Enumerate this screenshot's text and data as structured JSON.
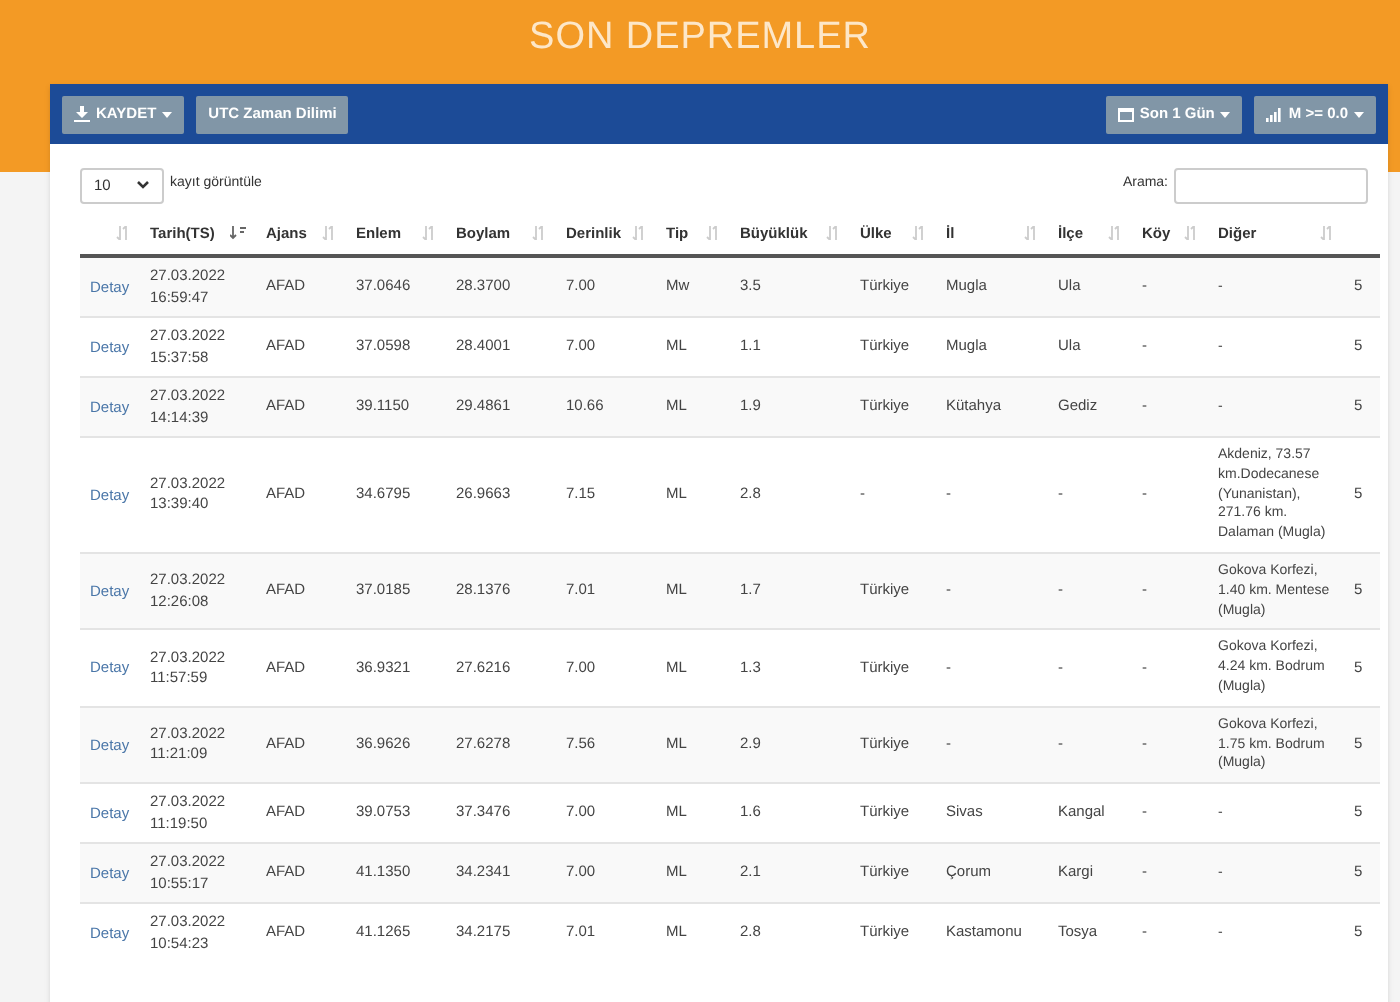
{
  "header": {
    "title": "SON DEPREMLER"
  },
  "toolbar": {
    "left_buttons": [
      {
        "label": "KAYDET",
        "dropdown": true
      },
      {
        "label": "UTC Zaman Dilimi",
        "dropdown": false
      }
    ],
    "right_buttons": [
      {
        "label": "Son 1 Gün",
        "dropdown": true
      },
      {
        "label": "M >= 0.0",
        "dropdown": true
      }
    ]
  },
  "length_select": {
    "value": "10",
    "label": "kayıt görüntüle"
  },
  "search": {
    "label": "Arama:"
  },
  "table": {
    "columns": [
      {
        "sorted": false
      },
      {
        "label": "Tarih(TS)",
        "sorted": true
      },
      {
        "label": "Ajans",
        "sorted": false
      },
      {
        "label": "Enlem",
        "sorted": false
      },
      {
        "label": "Boylam",
        "sorted": false
      },
      {
        "label": "Derinlik",
        "sorted": false
      },
      {
        "label": "Tip",
        "sorted": false
      },
      {
        "label": "Büyüklük",
        "sorted": false
      },
      {
        "label": "Ülke",
        "sorted": false
      },
      {
        "label": "İl",
        "sorted": false
      },
      {
        "label": "İlçe",
        "sorted": false
      },
      {
        "label": "Köy",
        "sorted": false
      },
      {
        "label": "Diğer",
        "sorted": false
      }
    ],
    "rows": [
      {
        "link": "Detay",
        "date": "27.03.2022",
        "time": "16:59:47",
        "agency": "AFAD",
        "lat": "37.0646",
        "lon": "28.3700",
        "depth": "7.00",
        "type": "Mw",
        "mag": "3.5",
        "country": "Türkiye",
        "province": "Mugla",
        "district": "Ula",
        "village": "-",
        "other": "-",
        "column_14": "5"
      },
      {
        "link": "Detay",
        "date": "27.03.2022",
        "time": "15:37:58",
        "agency": "AFAD",
        "lat": "37.0598",
        "lon": "28.4001",
        "depth": "7.00",
        "type": "ML",
        "mag": "1.1",
        "country": "Türkiye",
        "province": "Mugla",
        "district": "Ula",
        "village": "-",
        "other": "-",
        "column_14": "5"
      },
      {
        "link": "Detay",
        "date": "27.03.2022",
        "time": "14:14:39",
        "agency": "AFAD",
        "lat": "39.1150",
        "lon": "29.4861",
        "depth": "10.66",
        "type": "ML",
        "mag": "1.9",
        "country": "Türkiye",
        "province": "Kütahya",
        "district": "Gediz",
        "village": "-",
        "other": "-",
        "column_14": "5"
      },
      {
        "link": "Detay",
        "date": "27.03.2022",
        "time": "13:39:40",
        "agency": "AFAD",
        "lat": "34.6795",
        "lon": "26.9663",
        "depth": "7.15",
        "type": "ML",
        "mag": "2.8",
        "country": "-",
        "province": "-",
        "district": "-",
        "village": "-",
        "other": "Akdeniz, 73.57 km.Dodecanese (Yunanistan), 271.76 km. Dalaman (Mugla)",
        "column_14": "5"
      },
      {
        "link": "Detay",
        "date": "27.03.2022",
        "time": "12:26:08",
        "agency": "AFAD",
        "lat": "37.0185",
        "lon": "28.1376",
        "depth": "7.01",
        "type": "ML",
        "mag": "1.7",
        "country": "Türkiye",
        "province": "-",
        "district": "-",
        "village": "-",
        "other": "Gokova Korfezi, 1.40 km. Mentese (Mugla)",
        "column_14": "5"
      },
      {
        "link": "Detay",
        "date": "27.03.2022",
        "time": "11:57:59",
        "agency": "AFAD",
        "lat": "36.9321",
        "lon": "27.6216",
        "depth": "7.00",
        "type": "ML",
        "mag": "1.3",
        "country": "Türkiye",
        "province": "-",
        "district": "-",
        "village": "-",
        "other": "Gokova Korfezi, 4.24 km. Bodrum (Mugla)",
        "column_14": "5"
      },
      {
        "link": "Detay",
        "date": "27.03.2022",
        "time": "11:21:09",
        "agency": "AFAD",
        "lat": "36.9626",
        "lon": "27.6278",
        "depth": "7.56",
        "type": "ML",
        "mag": "2.9",
        "country": "Türkiye",
        "province": "-",
        "district": "-",
        "village": "-",
        "other": "Gokova Korfezi, 1.75 km. Bodrum (Mugla)",
        "column_14": "5"
      },
      {
        "link": "Detay",
        "date": "27.03.2022",
        "time": "11:19:50",
        "agency": "AFAD",
        "lat": "39.0753",
        "lon": "37.3476",
        "depth": "7.00",
        "type": "ML",
        "mag": "1.6",
        "country": "Türkiye",
        "province": "Sivas",
        "district": "Kangal",
        "village": "-",
        "other": "-",
        "column_14": "5"
      },
      {
        "link": "Detay",
        "date": "27.03.2022",
        "time": "10:55:17",
        "agency": "AFAD",
        "lat": "41.1350",
        "lon": "34.2341",
        "depth": "7.00",
        "type": "ML",
        "mag": "2.1",
        "country": "Türkiye",
        "province": "Çorum",
        "district": "Kargi",
        "village": "-",
        "other": "-",
        "column_14": "5"
      },
      {
        "link": "Detay",
        "date": "27.03.2022",
        "time": "10:54:23",
        "agency": "AFAD",
        "lat": "41.1265",
        "lon": "34.2175",
        "depth": "7.01",
        "type": "ML",
        "mag": "2.8",
        "country": "Türkiye",
        "province": "Kastamonu",
        "district": "Tosya",
        "village": "-",
        "other": "-",
        "column_14": "5"
      }
    ]
  }
}
